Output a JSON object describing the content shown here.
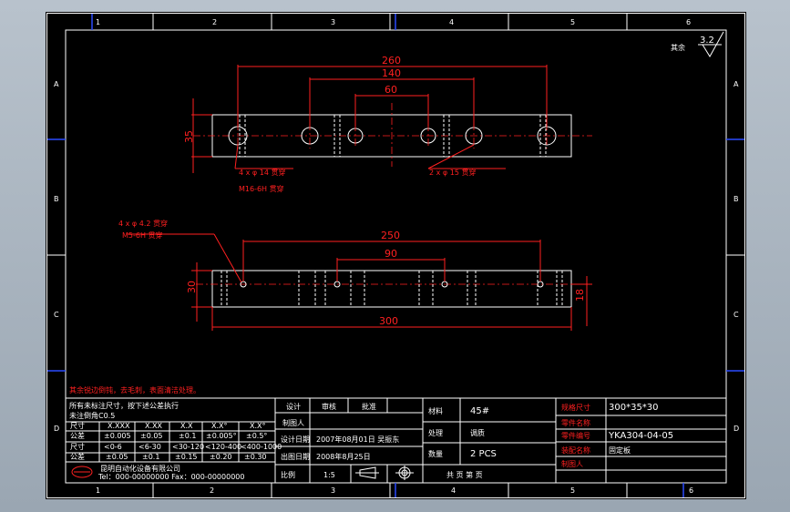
{
  "frame": {
    "zones_top": [
      "1",
      "2",
      "3",
      "4",
      "5",
      "6"
    ],
    "zones_bottom": [
      "1",
      "2",
      "3",
      "4",
      "5",
      "6"
    ],
    "zones_left": [
      "A",
      "B",
      "C",
      "D"
    ],
    "zones_right": [
      "A",
      "B",
      "C",
      "D"
    ]
  },
  "surface": {
    "prefix": "其余",
    "value": "3.2"
  },
  "top_view": {
    "dim_overall": "260",
    "dim_mid": "140",
    "dim_inner": "60",
    "dim_height": "35",
    "note_left_line1": "4 x φ  14 贯穿",
    "note_left_line2": "M16-6H 贯穿",
    "note_right": "2 x φ  15 贯穿"
  },
  "front_view": {
    "note_line1": "4 x φ  4.2 贯穿",
    "note_line2": "M5-6H 贯穿",
    "dim_250": "250",
    "dim_90": "90",
    "dim_30": "30",
    "dim_18": "18",
    "dim_300": "300"
  },
  "notes": {
    "red": "其余锐边倒钝，去毛刺，表面清洁处理。",
    "line1": "所有未标注尺寸，按下述公差执行",
    "line2": "未注倒角C0.5"
  },
  "tolerance_table": {
    "head": [
      "尺寸",
      "X.XXX",
      "X.XX",
      "X.X",
      "X.X°",
      "X.X°"
    ],
    "row1": [
      "公差",
      "±0.005",
      "±0.05",
      "±0.1",
      "±0.005°",
      "±0.5°"
    ],
    "row2": [
      "尺寸",
      "<0-6",
      "<6-30",
      "<30-120",
      "<120-400",
      "<400-1000"
    ],
    "row3": [
      "公差",
      "±0.05",
      "±0.1",
      "±0.15",
      "±0.20",
      "±0.30"
    ]
  },
  "company": "昆明自动化设备有限公司",
  "company_sub": "Tel：000-00000000  Fax：000-00000000",
  "signoff": {
    "design": "设计",
    "review": "审核",
    "approve": "批准",
    "drawn_by": "制图人",
    "design_date_label": "设计日期",
    "design_date_value": "2007年08月01日 吴振东",
    "print_date_label": "出图日期",
    "print_date_value": "2008年8月25日",
    "scale_label": "比例",
    "scale_value": "1:5"
  },
  "material": {
    "material_label": "材料",
    "material_value": "45#",
    "treatment_label": "处理",
    "treatment_value": "调质",
    "qty_label": "数量",
    "qty_value": "2  PCS",
    "sheet_text": "共  页  第  页"
  },
  "title_block": {
    "spec_label": "规格尺寸",
    "spec_value": "300*35*30",
    "name_label": "零件名称",
    "name_value": "",
    "drawing_no_label": "零件编号",
    "drawing_no_value": "YKA304-04-05",
    "assembly_label": "装配名称",
    "assembly_value": "固定板",
    "drawing_by_label": "制图人",
    "drawing_by_value": ""
  }
}
